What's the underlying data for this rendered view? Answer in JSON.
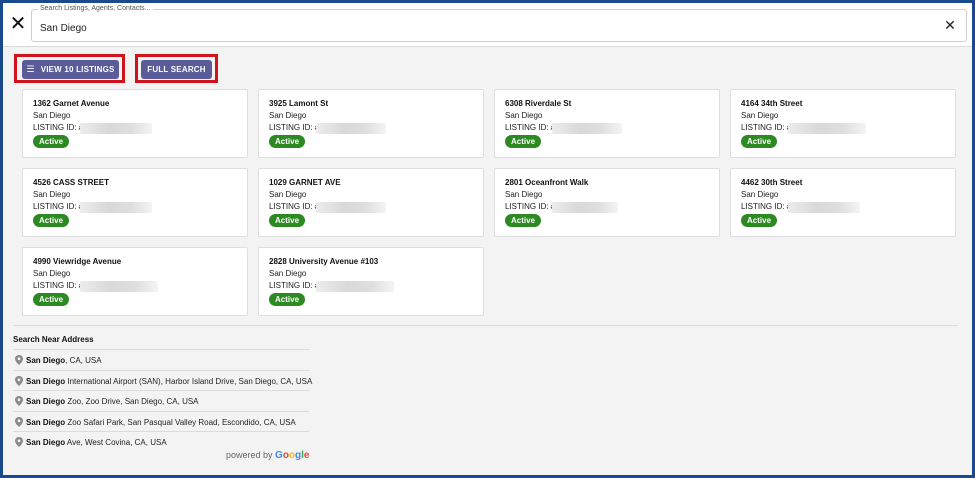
{
  "search": {
    "label": "Search Listings, Agents, Contacts...",
    "value": "San Diego"
  },
  "icons": {
    "close": "close-icon",
    "clear": "clear-icon",
    "list": "list-icon",
    "pin": "map-pin-icon"
  },
  "buttons": {
    "view_listings": "VIEW 10 LISTINGS",
    "full_search": "FULL SEARCH"
  },
  "colors": {
    "button": "#5a5b99",
    "highlight": "#d0121b",
    "active_badge": "#2d8a22",
    "frame": "#1b4a8c"
  },
  "listings": [
    {
      "address": "1362 Garnet Avenue",
      "city": "San Diego",
      "id_label": "LISTING ID: #",
      "status": "Active"
    },
    {
      "address": "3925 Lamont St",
      "city": "San Diego",
      "id_label": "LISTING ID: #",
      "status": "Active"
    },
    {
      "address": "6308 Riverdale St",
      "city": "San Diego",
      "id_label": "LISTING ID: #",
      "status": "Active"
    },
    {
      "address": "4164 34th Street",
      "city": "San Diego",
      "id_label": "LISTING ID: #",
      "status": "Active"
    },
    {
      "address": "4526 CASS STREET",
      "city": "San Diego",
      "id_label": "LISTING ID: #",
      "status": "Active"
    },
    {
      "address": "1029 GARNET AVE",
      "city": "San Diego",
      "id_label": "LISTING ID: #",
      "status": "Active"
    },
    {
      "address": "2801 Oceanfront Walk",
      "city": "San Diego",
      "id_label": "LISTING ID: #",
      "status": "Active"
    },
    {
      "address": "4462 30th Street",
      "city": "San Diego",
      "id_label": "LISTING ID: #",
      "status": "Active"
    },
    {
      "address": "4990 Viewridge Avenue",
      "city": "San Diego",
      "id_label": "LISTING ID: #",
      "status": "Active"
    },
    {
      "address": "2828 University Avenue #103",
      "city": "San Diego",
      "id_label": "LISTING ID: #",
      "status": "Active"
    }
  ],
  "near": {
    "title": "Search Near Address",
    "items": [
      {
        "match": "San Diego",
        "rest": ", CA, USA"
      },
      {
        "match": "San Diego",
        "rest": " International Airport (SAN), Harbor Island Drive, San Diego, CA, USA"
      },
      {
        "match": "San Diego",
        "rest": " Zoo, Zoo Drive, San Diego, CA, USA"
      },
      {
        "match": "San Diego",
        "rest": " Zoo Safari Park, San Pasqual Valley Road, Escondido, CA, USA"
      },
      {
        "match": "San Diego",
        "rest": " Ave, West Covina, CA, USA"
      }
    ]
  },
  "attribution": {
    "prefix": "powered by ",
    "brand": [
      "G",
      "o",
      "o",
      "g",
      "l",
      "e"
    ],
    "brand_colors": [
      "#4285f4",
      "#ea4335",
      "#fbbc05",
      "#4285f4",
      "#34a853",
      "#ea4335"
    ]
  }
}
